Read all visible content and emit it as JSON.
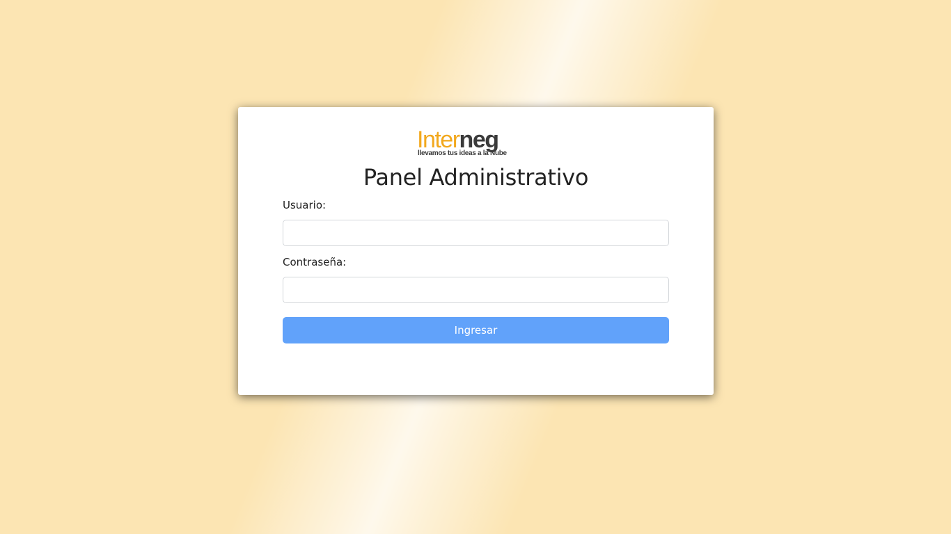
{
  "logo": {
    "word_part_a": "Inter",
    "word_part_b": "neg",
    "tagline": "llevamos tus ideas a la Nube"
  },
  "title": "Panel Administrativo",
  "form": {
    "user_label": "Usuario:",
    "user_value": "",
    "password_label": "Contraseña:",
    "password_value": "",
    "submit_label": "Ingresar"
  },
  "colors": {
    "background": "#fce5b3",
    "brand_orange": "#f2a81d",
    "brand_dark": "#3a3a3a",
    "button": "#61a2fa"
  }
}
